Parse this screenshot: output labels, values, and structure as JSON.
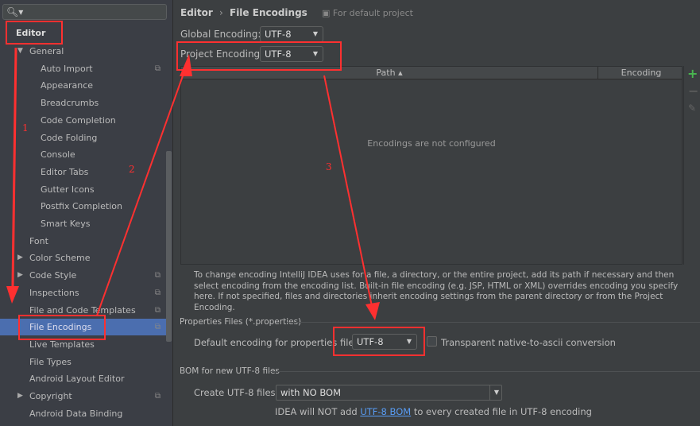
{
  "search": {
    "value": "",
    "icon": "search-icon"
  },
  "sidebar": {
    "items": [
      {
        "label": "Editor",
        "level": 0,
        "bold": true
      },
      {
        "label": "General",
        "level": 1,
        "expander": "expanded"
      },
      {
        "label": "Auto Import",
        "level": 2,
        "copy": true
      },
      {
        "label": "Appearance",
        "level": 2
      },
      {
        "label": "Breadcrumbs",
        "level": 2
      },
      {
        "label": "Code Completion",
        "level": 2
      },
      {
        "label": "Code Folding",
        "level": 2
      },
      {
        "label": "Console",
        "level": 2
      },
      {
        "label": "Editor Tabs",
        "level": 2
      },
      {
        "label": "Gutter Icons",
        "level": 2
      },
      {
        "label": "Postfix Completion",
        "level": 2
      },
      {
        "label": "Smart Keys",
        "level": 2
      },
      {
        "label": "Font",
        "level": 1
      },
      {
        "label": "Color Scheme",
        "level": 1,
        "expander": "collapsed"
      },
      {
        "label": "Code Style",
        "level": 1,
        "expander": "collapsed",
        "copy": true
      },
      {
        "label": "Inspections",
        "level": 1,
        "copy": true
      },
      {
        "label": "File and Code Templates",
        "level": 1,
        "copy": true
      },
      {
        "label": "File Encodings",
        "level": 1,
        "copy": true,
        "selected": true
      },
      {
        "label": "Live Templates",
        "level": 1
      },
      {
        "label": "File Types",
        "level": 1
      },
      {
        "label": "Android Layout Editor",
        "level": 1
      },
      {
        "label": "Copyright",
        "level": 1,
        "expander": "collapsed",
        "copy": true
      },
      {
        "label": "Android Data Binding",
        "level": 1
      }
    ]
  },
  "breadcrumb": {
    "parent": "Editor",
    "sep": "›",
    "current": "File Encodings",
    "scope": "For default project"
  },
  "global_encoding": {
    "label": "Global Encoding:",
    "value": "UTF-8"
  },
  "project_encoding": {
    "label": "Project Encoding:",
    "value": "UTF-8"
  },
  "table": {
    "columns": [
      "Path ▴",
      "Encoding"
    ],
    "empty_text": "Encodings are not configured"
  },
  "help_text": "To change encoding IntelliJ IDEA uses for a file, a directory, or the entire project, add its path if necessary and then select encoding from the encoding list. Built-in file encoding (e.g. JSP, HTML or XML) overrides encoding you specify here. If not specified, files and directories inherit encoding settings from the parent directory or from the Project Encoding.",
  "properties": {
    "section": "Properties Files (*.properties)",
    "label": "Default encoding for properties files:",
    "value": "UTF-8",
    "checkbox_label": "Transparent native-to-ascii conversion",
    "checked": false
  },
  "bom": {
    "section": "BOM for new UTF-8 files",
    "label": "Create UTF-8 files:",
    "value": "with NO BOM",
    "note_pre": "IDEA will NOT add ",
    "note_link": "UTF-8 BOM",
    "note_post": " to every created file in UTF-8 encoding"
  },
  "annotations": {
    "numbers": [
      "1",
      "2",
      "3"
    ],
    "color": "#ff3030"
  },
  "colors": {
    "accent": "#4b6eaf",
    "add": "#49b650",
    "link": "#589df6"
  }
}
